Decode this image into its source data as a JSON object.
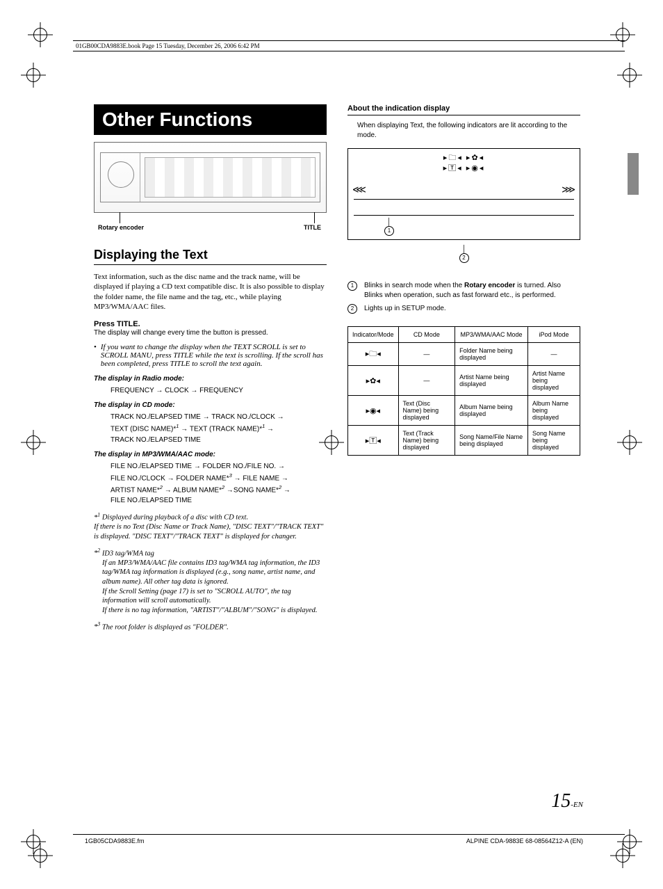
{
  "book_line": "01GB00CDA9883E.book  Page 15  Tuesday, December 26, 2006  6:42 PM",
  "title": "Other Functions",
  "device": {
    "label_left": "Rotary encoder",
    "label_right": "TITLE"
  },
  "section": "Displaying the Text",
  "intro": "Text information, such as the disc name and the track name, will be displayed if playing a CD text compatible disc. It is also possible to display the folder name, the file name and the tag, etc., while playing MP3/WMA/AAC files.",
  "press": {
    "prefix": "Press ",
    "btn": "TITLE",
    "suffix": "."
  },
  "press_sub": "The display will change every time the button is pressed.",
  "bullet": "If you want to change the display when the TEXT SCROLL is set to SCROLL MANU, press TITLE while the text is scrolling. If the scroll has been completed, press TITLE to scroll the text again.",
  "radio": {
    "head": "The display in Radio mode:",
    "body": "FREQUENCY → CLOCK → FREQUENCY"
  },
  "cd": {
    "head": "The display in CD mode:",
    "l1": "TRACK NO./ELAPSED TIME → TRACK NO./CLOCK →",
    "l2a": "TEXT (DISC NAME)*",
    "l2b": " → TEXT (TRACK NAME)*",
    "l2c": " →",
    "l3": "TRACK NO./ELAPSED TIME"
  },
  "mp3": {
    "head": "The display in MP3/WMA/AAC mode:",
    "l1": "FILE NO./ELAPSED TIME → FOLDER NO./FILE NO. →",
    "l2a": "FILE NO./CLOCK → FOLDER NAME*",
    "l2b": " → FILE NAME →",
    "l3a": "ARTIST NAME*",
    "l3b": " → ALBUM NAME*",
    "l3c": " →SONG NAME*",
    "l3d": " →",
    "l4": "FILE NO./ELAPSED TIME"
  },
  "fn1": {
    "lbl": "*1",
    "body": "Displayed during playback of a disc with CD text.\nIf there is no Text (Disc Name or Track Name), \"DISC TEXT\"/\"TRACK TEXT\" is displayed. \"DISC TEXT\"/\"TRACK TEXT\" is displayed for changer."
  },
  "fn2": {
    "lbl": "*2",
    "head": "ID3 tag/WMA tag",
    "body": "If an MP3/WMA/AAC file contains ID3 tag/WMA tag information, the ID3 tag/WMA tag information is displayed (e.g., song name, artist name, and album name). All other tag data is ignored.\nIf the Scroll Setting (page 17) is set to \"SCROLL AUTO\", the tag information will scroll automatically.\nIf there is no tag information, \"ARTIST\"/\"ALBUM\"/\"SONG\" is displayed."
  },
  "fn3": {
    "lbl": "*3",
    "body": "The root folder is displayed as \"FOLDER\"."
  },
  "right": {
    "subhead": "About the indication display",
    "text": "When displaying Text, the following indicators are lit according to the mode.",
    "note1a": "Blinks in search mode when the ",
    "note1b": "Rotary encoder",
    "note1c": " is turned. Also Blinks when operation, such as fast forward etc., is performed.",
    "note2": "Lights up in SETUP mode."
  },
  "table": {
    "h1": "Indicator/Mode",
    "h2": "CD Mode",
    "h3": "MP3/WMA/AAC Mode",
    "h4": "iPod Mode",
    "rows": [
      {
        "icon": "▸🗀◂",
        "cd": "—",
        "mp3": "Folder Name being displayed",
        "ipod": "—"
      },
      {
        "icon": "▸✿◂",
        "cd": "—",
        "mp3": "Artist Name being displayed",
        "ipod": "Artist Name being displayed"
      },
      {
        "icon": "▸◉◂",
        "cd": "Text (Disc Name) being displayed",
        "mp3": "Album Name being displayed",
        "ipod": "Album Name being displayed"
      },
      {
        "icon": "▸🅃◂",
        "cd": "Text (Track Name) being displayed",
        "mp3": "Song Name/File Name being displayed",
        "ipod": "Song Name being displayed"
      }
    ]
  },
  "page_number": "15",
  "page_suffix": "-EN",
  "foot_left": "1GB05CDA9883E.fm",
  "foot_right": "ALPINE CDA-9883E 68-08564Z12-A (EN)"
}
